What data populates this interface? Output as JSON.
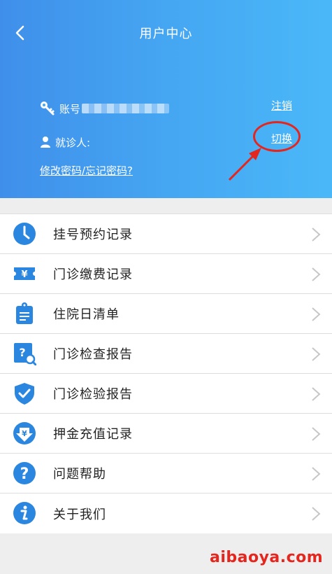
{
  "header": {
    "title": "用户中心",
    "account_label": "账号",
    "patient_label": "就诊人:",
    "logout_link": "注销",
    "switch_link": "切换",
    "change_password_link": "修改密码/忘记密码?"
  },
  "menu": {
    "items": [
      {
        "label": "挂号预约记录",
        "icon": "clock-icon"
      },
      {
        "label": "门诊缴费记录",
        "icon": "ticket-yen-icon"
      },
      {
        "label": "住院日清单",
        "icon": "clipboard-icon"
      },
      {
        "label": "门诊检查报告",
        "icon": "question-search-icon"
      },
      {
        "label": "门诊检验报告",
        "icon": "shield-check-icon"
      },
      {
        "label": "押金充值记录",
        "icon": "yen-down-icon"
      },
      {
        "label": "问题帮助",
        "icon": "question-icon"
      },
      {
        "label": "关于我们",
        "icon": "info-icon"
      }
    ]
  },
  "colors": {
    "header_start": "#3f8fea",
    "header_end": "#4ab8f8",
    "icon_blue": "#2b86e0",
    "annotation_red": "#e5261f"
  },
  "watermark": "aibaoya.com"
}
